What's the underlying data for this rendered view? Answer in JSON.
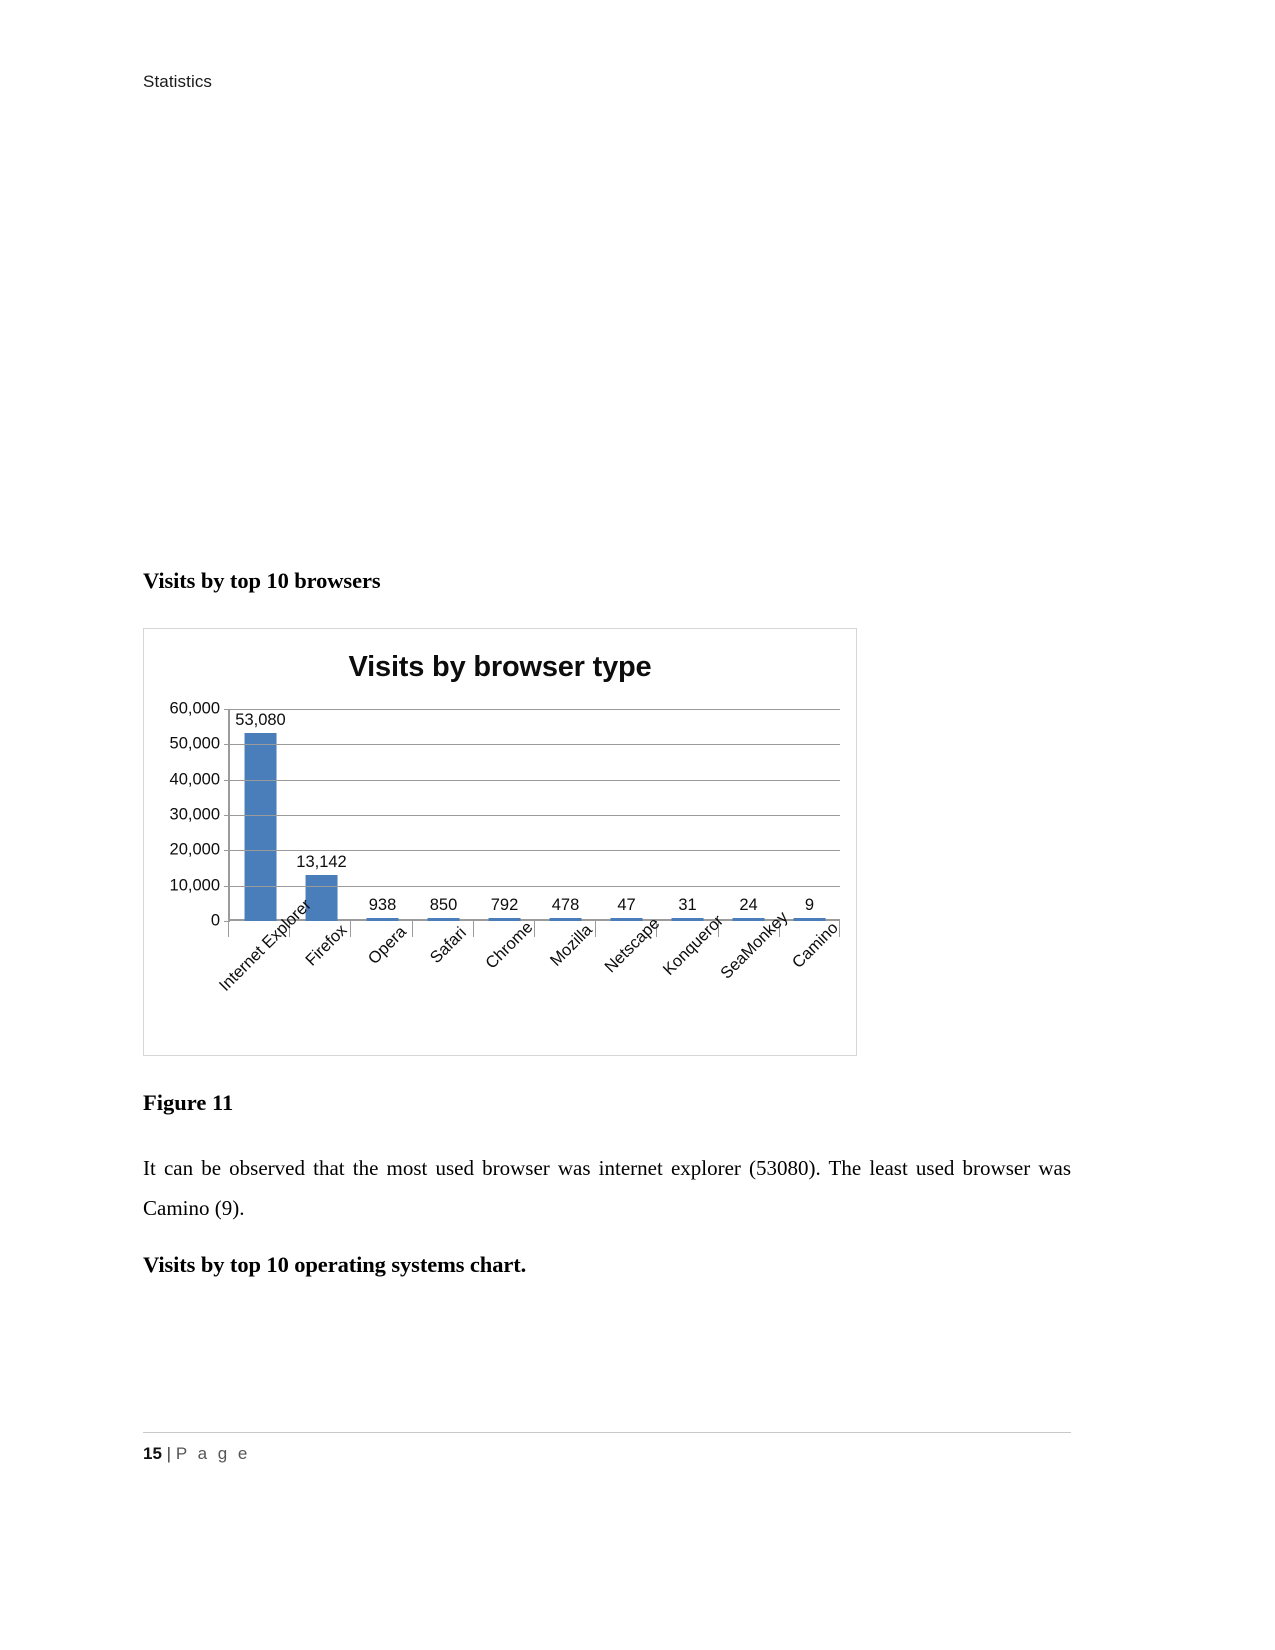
{
  "document": {
    "running_header": "Statistics",
    "heading_browsers": "Visits by top 10 browsers",
    "figure_caption": "Figure 11",
    "body_paragraph": "It can be observed that the most used browser was internet explorer (53080). The least used browser was Camino (9).",
    "heading_operating_systems": "Visits by top 10 operating systems chart."
  },
  "footer": {
    "page_number": "15",
    "separator": "|",
    "page_word": "P a g e"
  },
  "colors": {
    "bar": "#4a7ebb",
    "gridline": "#9b9b9b",
    "chart_border": "#d6d6d6"
  },
  "chart_data": {
    "type": "bar",
    "title": "Visits by browser type",
    "xlabel": "",
    "ylabel": "",
    "categories": [
      "Internet Explorer",
      "Firefox",
      "Opera",
      "Safari",
      "Chrome",
      "Mozilla",
      "Netscape",
      "Konqueror",
      "SeaMonkey",
      "Camino"
    ],
    "values": [
      53080,
      13142,
      938,
      850,
      792,
      478,
      47,
      31,
      24,
      9
    ],
    "data_labels": [
      "53,080",
      "13,142",
      "938",
      "850",
      "792",
      "478",
      "47",
      "31",
      "24",
      "9"
    ],
    "ylim": [
      0,
      60000
    ],
    "ytick_values": [
      60000,
      50000,
      40000,
      30000,
      20000,
      10000,
      0
    ],
    "ytick_labels": [
      "60,000",
      "50,000",
      "40,000",
      "30,000",
      "20,000",
      "10,000",
      "0"
    ],
    "grid": true,
    "legend": false,
    "series": [
      {
        "name": "Visits",
        "values": [
          53080,
          13142,
          938,
          850,
          792,
          478,
          47,
          31,
          24,
          9
        ]
      }
    ]
  }
}
